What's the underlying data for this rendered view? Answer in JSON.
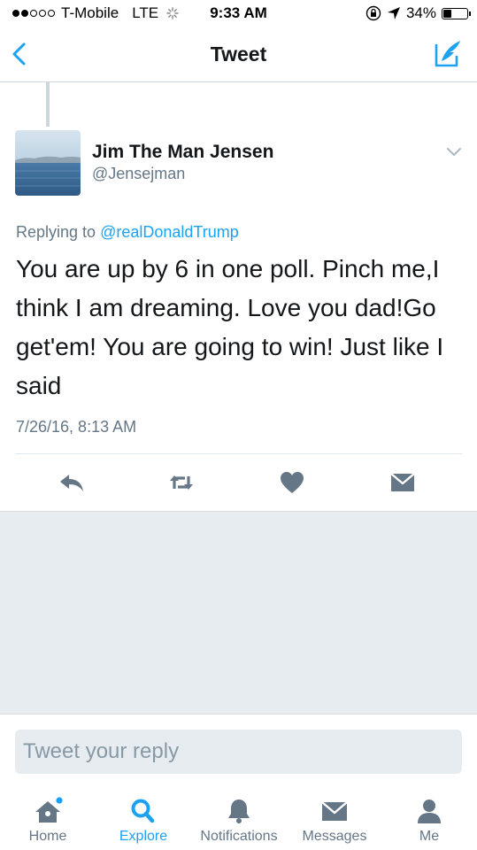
{
  "status_bar": {
    "carrier": "T-Mobile",
    "network": "LTE",
    "time": "9:33 AM",
    "battery": "34%"
  },
  "nav": {
    "title": "Tweet",
    "back_icon": "chevron-left-icon",
    "compose_icon": "compose-tweet-icon"
  },
  "tweet": {
    "author_name": "Jim The Man Jensen",
    "author_handle": "@Jensejman",
    "replying_prefix": "Replying to",
    "replying_to": "@realDonaldTrump",
    "text": "You are up by 6 in one poll. Pinch me,I think I am dreaming. Love you dad!Go get'em! You are going to win! Just like I said",
    "timestamp": "7/26/16, 8:13 AM"
  },
  "actions": [
    "reply-icon",
    "retweet-icon",
    "like-icon",
    "direct-message-icon"
  ],
  "reply_box": {
    "placeholder": "Tweet your reply"
  },
  "tabs": [
    {
      "label": "Home",
      "icon": "home-icon"
    },
    {
      "label": "Explore",
      "icon": "search-icon",
      "active": true
    },
    {
      "label": "Notifications",
      "icon": "bell-icon"
    },
    {
      "label": "Messages",
      "icon": "envelope-icon"
    },
    {
      "label": "Me",
      "icon": "person-icon"
    }
  ],
  "colors": {
    "accent": "#1da1f2",
    "text": "#14171a",
    "secondary_text": "#657786",
    "icon_gray": "#657786",
    "background_gray": "#e6ecf0"
  }
}
